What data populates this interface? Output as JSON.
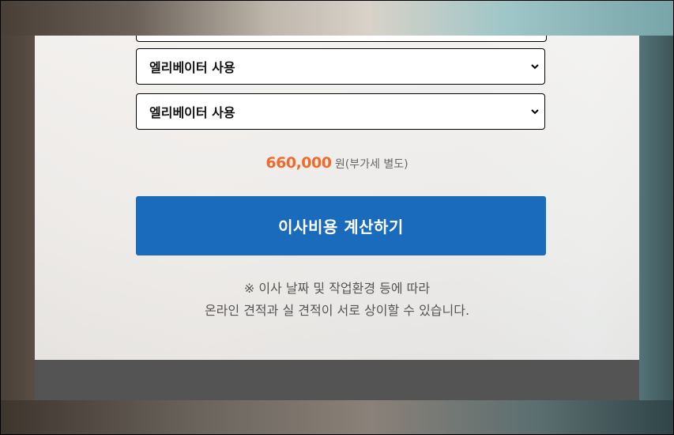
{
  "form": {
    "select_1": {
      "value": "엘리베이터 사용"
    },
    "select_2": {
      "value": "엘리베이터 사용"
    }
  },
  "price": {
    "amount": "660,000",
    "unit": "원",
    "vat_note": "(부가세 별도)"
  },
  "calculate_button": {
    "label": "이사비용 계산하기"
  },
  "notice": {
    "line_1": "※ 이사 날짜 및 작업환경 등에 따라",
    "line_2": "온라인 견적과 실 견적이 서로 상이할 수 있습니다."
  }
}
